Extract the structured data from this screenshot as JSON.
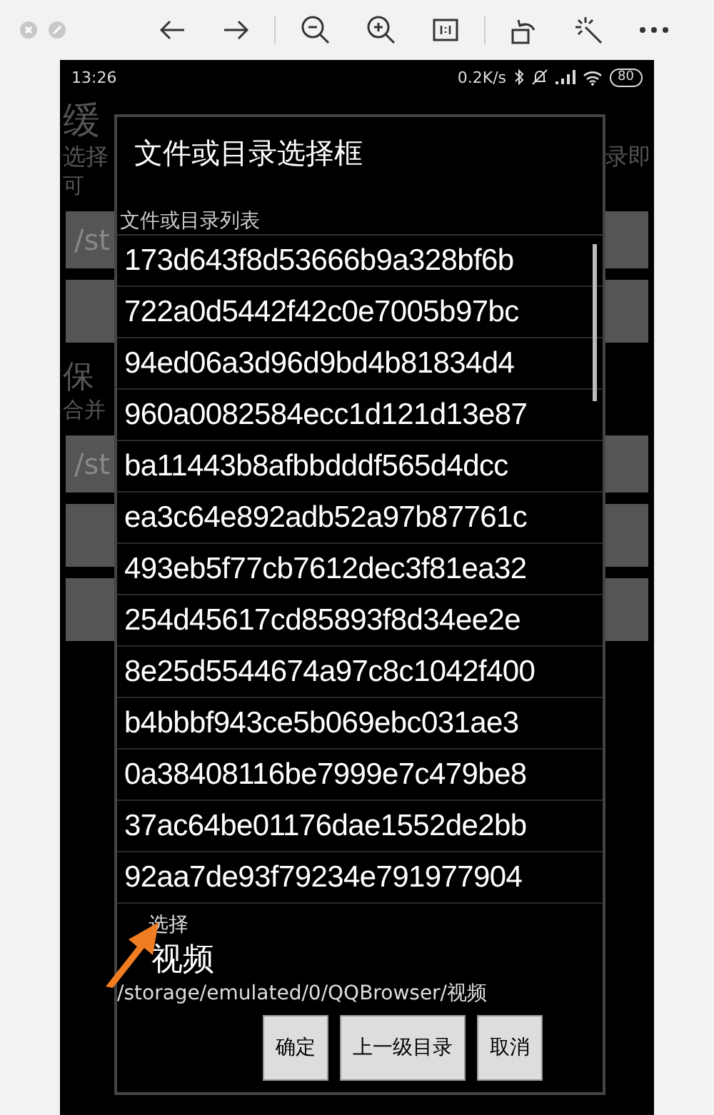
{
  "status_bar": {
    "time": "13:26",
    "speed": "0.2K/s",
    "battery": "80"
  },
  "background": {
    "title": "缓",
    "hint_left": "选择",
    "hint_right": "录即",
    "hint_end": "可",
    "field_1": "/st",
    "section": "保",
    "section_hint": "合并",
    "field_2": "/st"
  },
  "dialog": {
    "title": "文件或目录选择框",
    "list_label": "文件或目录列表",
    "items": [
      "173d643f8d53666b9a328bf6b",
      "722a0d5442f42c0e7005b97bc",
      "94ed06a3d96d9bd4b81834d4",
      "960a0082584ecc1d121d13e87",
      "ba11443b8afbbdddf565d4dcc",
      "ea3c64e892adb52a97b87761c",
      "493eb5f77cb7612dec3f81ea32",
      "254d45617cd85893f8d34ee2e",
      "8e25d5544674a97c8c1042f400",
      "b4bbbf943ce5b069ebc031ae3",
      "0a38408116be7999e7c479be8",
      "37ac64be01176dae1552de2bb",
      "92aa7de93f79234e791977904"
    ],
    "current_label": "选择",
    "current_name": "视频",
    "current_path": "/storage/emulated/0/QQBrowser/视频",
    "buttons": [
      "确定",
      "上一级目录",
      "取消"
    ]
  }
}
